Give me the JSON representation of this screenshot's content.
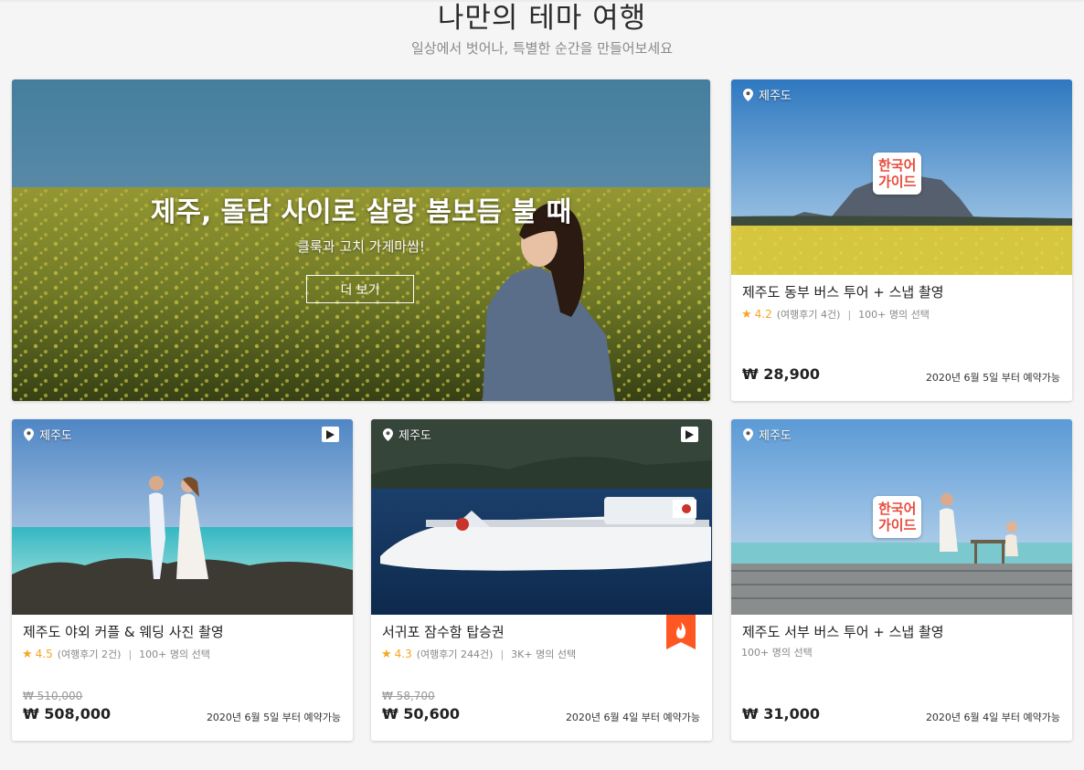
{
  "section": {
    "title": "나만의 테마 여행",
    "subtitle": "일상에서 벗어나, 특별한 순간을 만들어보세요"
  },
  "hero": {
    "title": "제주, 돌담 사이로 살랑 봄보듬 불 때",
    "subtitle": "클룩과 고치 가게마씸!",
    "button_label": "더 보기"
  },
  "cards": [
    {
      "location": "제주도",
      "badge": "한국어\n가이드",
      "badge_line1": "한국어",
      "badge_line2": "가이드",
      "title": "제주도 동부 버스 투어 + 스냅 촬영",
      "rating": "4.2",
      "reviews": "(여행후기 4건)",
      "booked": "100+ 명의 선택",
      "price": "₩ 28,900",
      "availability": "2020년 6월 5일 부터 예약가능"
    },
    {
      "location": "제주도",
      "title": "제주도 야외 커플 & 웨딩 사진 촬영",
      "rating": "4.5",
      "reviews": "(여행후기 2건)",
      "booked": "100+ 명의 선택",
      "old_price": "₩ 510,000",
      "price": "₩ 508,000",
      "availability": "2020년 6월 5일 부터 예약가능"
    },
    {
      "location": "제주도",
      "title": "서귀포 잠수함 탑승권",
      "rating": "4.3",
      "reviews": "(여행후기 244건)",
      "booked": "3K+ 명의 선택",
      "old_price": "₩ 58,700",
      "price": "₩ 50,600",
      "availability": "2020년 6월 4일 부터 예약가능"
    },
    {
      "location": "제주도",
      "badge_line1": "한국어",
      "badge_line2": "가이드",
      "title": "제주도 서부 버스 투어 + 스냅 촬영",
      "booked": "100+ 명의 선택",
      "price": "₩ 31,000",
      "availability": "2020년 6월 4일 부터 예약가능"
    }
  ],
  "colors": {
    "accent_star": "#f5a623",
    "hot_badge": "#ff5722",
    "guide_text": "#e84a3b"
  },
  "icons": {
    "location": "location-pin-icon",
    "play": "play-icon",
    "hot": "fire-icon",
    "star": "star-icon"
  }
}
